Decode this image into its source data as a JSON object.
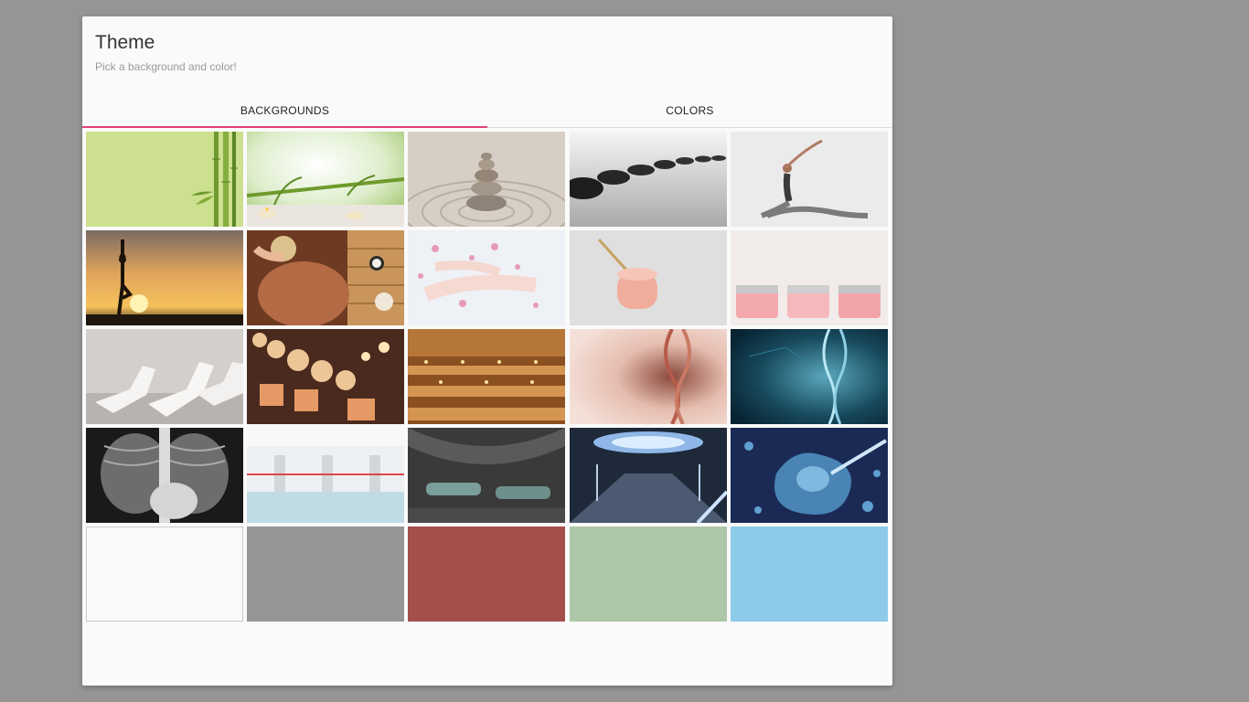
{
  "dialog": {
    "title": "Theme",
    "subtitle": "Pick a background and color!"
  },
  "tabs": [
    {
      "label": "BACKGROUNDS",
      "active": true
    },
    {
      "label": "COLORS",
      "active": false
    }
  ],
  "accent_color": "#e2407a",
  "backgrounds": [
    {
      "name": "bamboo-green"
    },
    {
      "name": "bamboo-candles"
    },
    {
      "name": "zen-stones-sand"
    },
    {
      "name": "black-pebbles-water"
    },
    {
      "name": "yoga-woman-stretch"
    },
    {
      "name": "yoga-sunset-silhouette"
    },
    {
      "name": "back-massage"
    },
    {
      "name": "flower-bath-feet"
    },
    {
      "name": "pink-cream-jar"
    },
    {
      "name": "pink-salt-jars"
    },
    {
      "name": "white-spa-loungers"
    },
    {
      "name": "candles-row"
    },
    {
      "name": "wooden-sauna"
    },
    {
      "name": "dna-pink"
    },
    {
      "name": "dna-blue"
    },
    {
      "name": "chest-xray"
    },
    {
      "name": "hospital-ward"
    },
    {
      "name": "futuristic-capsule-room"
    },
    {
      "name": "sci-fi-lab"
    },
    {
      "name": "cell-injection"
    },
    {
      "name": "solid-white",
      "color": "#fafafa"
    },
    {
      "name": "solid-gray",
      "color": "#959595"
    },
    {
      "name": "solid-red",
      "color": "#a54f4d"
    },
    {
      "name": "solid-sage",
      "color": "#adc7a8"
    },
    {
      "name": "solid-sky-blue",
      "color": "#8ecae9"
    }
  ]
}
